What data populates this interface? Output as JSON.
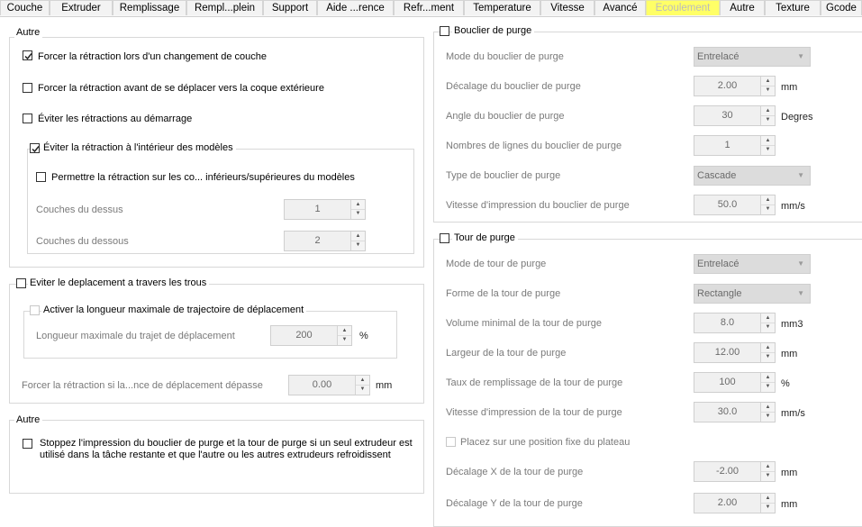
{
  "tabs": [
    {
      "label": "Couche"
    },
    {
      "label": "Extruder"
    },
    {
      "label": "Remplissage"
    },
    {
      "label": "Rempl...plein"
    },
    {
      "label": "Support"
    },
    {
      "label": "Aide ...rence"
    },
    {
      "label": "Refr...ment"
    },
    {
      "label": "Temperature"
    },
    {
      "label": "Vitesse"
    },
    {
      "label": "Avancé"
    },
    {
      "label": "Ecoulement"
    },
    {
      "label": "Autre"
    },
    {
      "label": "Texture"
    },
    {
      "label": "Gcode"
    }
  ],
  "active_tab": "Ecoulement",
  "autre1": {
    "title": "Autre",
    "force_retract_layer": "Forcer la rétraction lors d'un changement de couche",
    "force_retract_outer": "Forcer la rétraction avant de se déplacer vers la coque extérieure",
    "avoid_retract_start": "Éviter les rétractions au démarrage",
    "avoid_inside": {
      "title": "Éviter la rétraction à l'intérieur des modèles",
      "allow_topbottom": "Permettre la rétraction sur les co... inférieurs/supérieures du modèles",
      "top_layers_label": "Couches du dessus",
      "top_layers_value": "1",
      "bottom_layers_label": "Couches du dessous",
      "bottom_layers_value": "2"
    }
  },
  "holes": {
    "title": "Eviter le deplacement a travers les trous",
    "maxlen": {
      "title": "Activer la longueur maximale de trajectoire de déplacement",
      "label": "Longueur maximale du trajet de déplacement",
      "value": "200",
      "unit": "%"
    },
    "force_label": "Forcer la rétraction si la...nce de déplacement dépasse",
    "force_value": "0.00",
    "force_unit": "mm"
  },
  "autre2": {
    "title": "Autre",
    "stop_line1": "Stoppez l'impression du bouclier de purge et la tour de purge si un seul extrudeur est",
    "stop_line2": "utilisé dans la tâche restante et que l'autre ou les autres extrudeurs refroidissent"
  },
  "shield": {
    "title": "Bouclier de purge",
    "mode_label": "Mode du bouclier de purge",
    "mode_value": "Entrelacé",
    "offset_label": "Décalage du bouclier de purge",
    "offset_value": "2.00",
    "offset_unit": "mm",
    "angle_label": "Angle du bouclier de purge",
    "angle_value": "30",
    "angle_unit": "Degres",
    "lines_label": "Nombres de lignes du bouclier de purge",
    "lines_value": "1",
    "type_label": "Type de bouclier de purge",
    "type_value": "Cascade",
    "speed_label": "Vitesse d'impression du bouclier de purge",
    "speed_value": "50.0",
    "speed_unit": "mm/s"
  },
  "tower": {
    "title": "Tour de purge",
    "mode_label": "Mode de tour de purge",
    "mode_value": "Entrelacé",
    "shape_label": "Forme de la tour de purge",
    "shape_value": "Rectangle",
    "vol_label": "Volume minimal de la tour de purge",
    "vol_value": "8.0",
    "vol_unit": "mm3",
    "width_label": "Largeur de la tour de purge",
    "width_value": "12.00",
    "width_unit": "mm",
    "fill_label": "Taux de remplissage de la tour de purge",
    "fill_value": "100",
    "fill_unit": "%",
    "speed_label": "Vitesse d'impression de la tour de purge",
    "speed_value": "30.0",
    "speed_unit": "mm/s",
    "fixed_label": "Placez sur une position fixe du plateau",
    "x_label": "Décalage X de la tour de purge",
    "x_value": "-2.00",
    "x_unit": "mm",
    "y_label": "Décalage Y de la tour de purge",
    "y_value": "2.00",
    "y_unit": "mm"
  },
  "icons": {
    "checkmark": "checkmark-icon",
    "spin_up": "▲",
    "spin_down": "▼",
    "dropdown": "▼"
  },
  "colors": {
    "active_tab": "#ffff66",
    "disabled_text": "#b0b0b0"
  }
}
